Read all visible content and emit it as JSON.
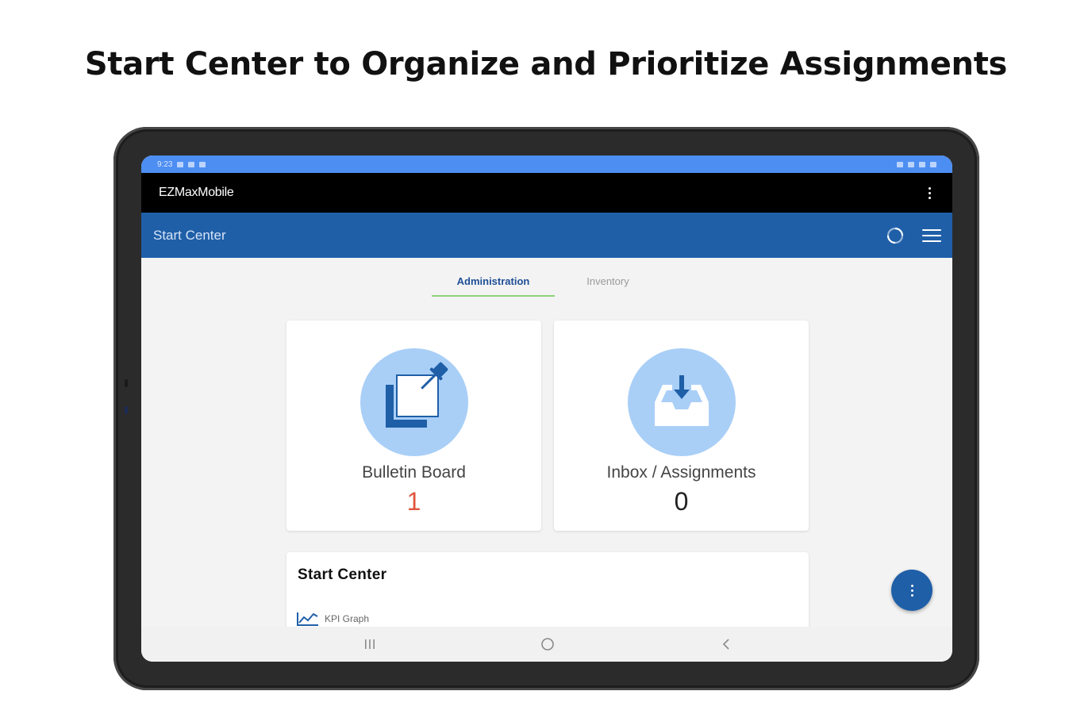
{
  "headline": "Start Center to Organize and Prioritize Assignments",
  "status_bar": {
    "time": "9:23"
  },
  "app_bar": {
    "title": "EZMaxMobile",
    "overflow_icon": "more-vert-icon"
  },
  "nav_bar": {
    "title": "Start Center",
    "refresh_icon": "refresh-icon",
    "menu_icon": "hamburger-menu-icon"
  },
  "tabs": [
    {
      "label": "Administration",
      "active": true
    },
    {
      "label": "Inventory",
      "active": false
    }
  ],
  "cards": [
    {
      "label": "Bulletin Board",
      "count": "1",
      "icon": "pinned-note-icon",
      "count_color": "#e0563d"
    },
    {
      "label": "Inbox / Assignments",
      "count": "0",
      "icon": "inbox-download-icon",
      "count_color": "#222222"
    }
  ],
  "start_center_panel": {
    "title": "Start Center",
    "items": [
      {
        "label": "KPI Graph",
        "icon": "line-graph-icon"
      }
    ]
  },
  "fab": {
    "icon": "more-vert-icon"
  },
  "system_nav": {
    "recents_icon": "recents-icon",
    "home_icon": "home-icon",
    "back_icon": "back-icon"
  },
  "colors": {
    "status_bar": "#4d8ef2",
    "app_bar": "#000000",
    "nav_bar": "#1f5fa8",
    "tab_active_text": "#1f4f96",
    "tab_underline": "#8fd27a",
    "icon_circle": "#a9cff7",
    "icon_fg": "#1f5fa8",
    "fab": "#1f5fa8"
  }
}
